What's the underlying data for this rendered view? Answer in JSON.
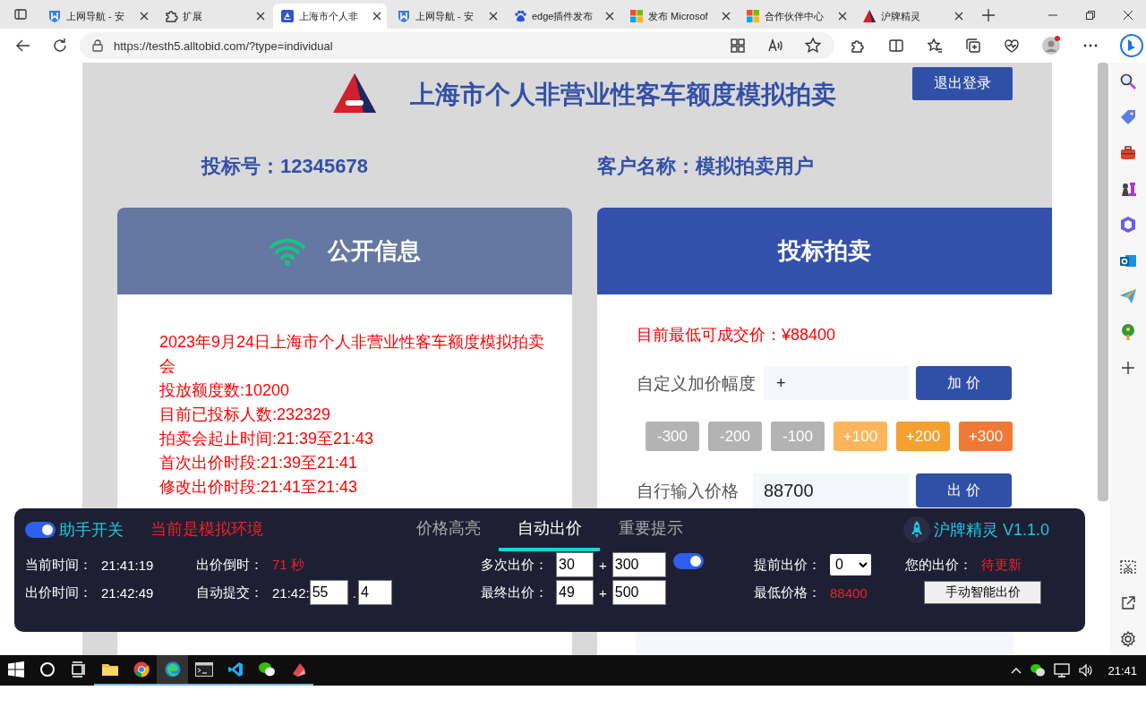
{
  "browser": {
    "tabs": [
      {
        "title": "上网导航 - 安",
        "kind": "shield",
        "selected": false
      },
      {
        "title": "扩展",
        "kind": "puzzle",
        "selected": false
      },
      {
        "title": "上海市个人非",
        "kind": "site",
        "selected": true
      },
      {
        "title": "上网导航 - 安",
        "kind": "shield",
        "selected": false
      },
      {
        "title": "edge插件发布",
        "kind": "paw",
        "selected": false
      },
      {
        "title": "发布 Microsof",
        "kind": "windows",
        "selected": false
      },
      {
        "title": "合作伙伴中心",
        "kind": "windows",
        "selected": false
      },
      {
        "title": "沪牌精灵",
        "kind": "triangle",
        "selected": false
      }
    ],
    "url": "https://testh5.alltobid.com/?type=individual"
  },
  "page": {
    "title": "上海市个人非营业性客车额度模拟拍卖",
    "logout": "退出登录",
    "bid_number": "投标号：12345678",
    "customer": "客户名称：模拟拍卖用户",
    "public_info": {
      "title": "公开信息",
      "lines": [
        "2023年9月24日上海市个人非营业性客车额度模拟拍卖会",
        "投放额度数:10200",
        "目前已投标人数:232329",
        "拍卖会起止时间:21:39至21:43",
        "首次出价时段:21:39至21:41",
        "修改出价时段:21:41至21:43"
      ]
    },
    "bidding": {
      "title": "投标拍卖",
      "lowest": "目前最低可成交价：¥88400",
      "custom_label": "自定义加价幅度",
      "custom_value": "+",
      "add_button": "加 价",
      "steps": [
        {
          "label": "-300",
          "color": "#b3b3b3"
        },
        {
          "label": "-200",
          "color": "#b3b3b3"
        },
        {
          "label": "-100",
          "color": "#b3b3b3"
        },
        {
          "label": "+100",
          "color": "#ffb55a"
        },
        {
          "label": "+200",
          "color": "#f5a030"
        },
        {
          "label": "+300",
          "color": "#f07a35"
        }
      ],
      "price_label": "自行输入价格",
      "price_value": "88700",
      "bid_button": "出 价"
    }
  },
  "helper": {
    "switch": {
      "label": "助手开关",
      "on": true
    },
    "environment": "当前是模拟环境",
    "tabs": [
      {
        "label": "价格高亮",
        "selected": false
      },
      {
        "label": "自动出价",
        "selected": true
      },
      {
        "label": "重要提示",
        "selected": false
      }
    ],
    "brand": "沪牌精灵 V1.1.0",
    "current_time": {
      "label": "当前时间：",
      "value": "21:41:19"
    },
    "bid_time": {
      "label": "出价时间：",
      "value": "21:42:49"
    },
    "countdown": {
      "label": "出价倒时：",
      "value": "71 秒"
    },
    "auto_submit": {
      "label": "自动提交：",
      "prefix": "21:42:",
      "seconds": "55",
      "dot": ".",
      "tenths": "4"
    },
    "multi_bid": {
      "label": "多次出价：",
      "first": "30",
      "plus": "+",
      "second": "300",
      "on": true
    },
    "final_bid": {
      "label": "最终出价：",
      "first": "49",
      "plus": "+",
      "second": "500"
    },
    "advance": {
      "label": "提前出价：",
      "value": "0"
    },
    "lowest": {
      "label": "最低价格：",
      "value": "88400"
    },
    "your_bid": {
      "label": "您的出价：",
      "value": "待更新"
    },
    "manual_button": "手动智能出价"
  },
  "taskbar": {
    "clock": "21:41"
  }
}
